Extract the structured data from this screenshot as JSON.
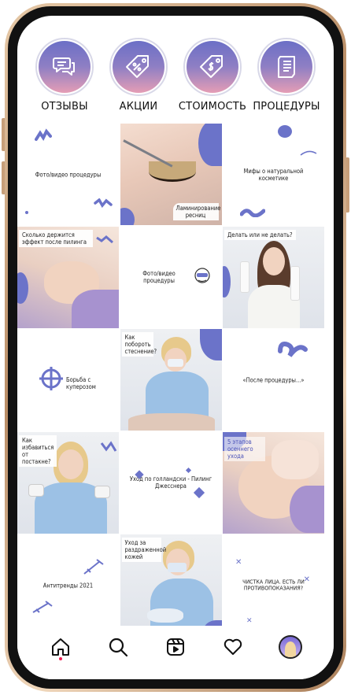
{
  "highlights": [
    {
      "label": "ОТЗЫВЫ",
      "icon": "chat-bubbles-icon"
    },
    {
      "label": "АКЦИИ",
      "icon": "percent-tag-icon"
    },
    {
      "label": "СТОИМОСТЬ",
      "icon": "price-tag-icon"
    },
    {
      "label": "ПРОЦЕДУРЫ",
      "icon": "document-list-icon"
    }
  ],
  "grid": {
    "row1": {
      "tile1": "Фото/видео процедуры",
      "tile2": "Ламинирование ресниц",
      "tile3": "Мифы о натуральной косметике"
    },
    "row2": {
      "tile1": "Сколько держится эффект после пилинга",
      "tile2": "Фото/видео процедуры",
      "tile3": "Делать или не делать?"
    },
    "row3": {
      "tile1": "Борьба с куперозом",
      "tile2": "Как побороть стеснение?",
      "tile3": "«После процедуры...»"
    },
    "row4": {
      "tile1": "Как избавиться от постакне?",
      "tile2": "Уход по голландски - Пилинг Джесснера",
      "tile3": "5 этапов осеннего ухода"
    },
    "row5": {
      "tile1": "Антитренды 2021",
      "tile2": "Уход за раздраженной кожей",
      "tile3": "Чистка лица. Есть ли противопоказания?"
    }
  },
  "colors": {
    "accent": "#6b73c9",
    "highlight_gradient_top": "#6b6fc6",
    "highlight_gradient_bottom": "#e59db5",
    "notification_dot": "#ee1d52",
    "phone_frame": "#c79f7a"
  },
  "bottom_nav": [
    "home-icon",
    "search-icon",
    "reels-icon",
    "heart-icon",
    "profile-avatar"
  ]
}
